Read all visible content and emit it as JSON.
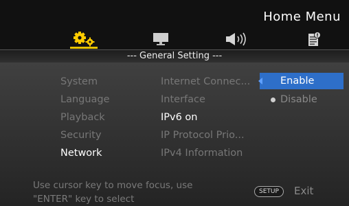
{
  "header": {
    "menu_title": "Home Menu",
    "tabs": [
      {
        "icon": "gear-icon",
        "selected": true
      },
      {
        "icon": "monitor-icon",
        "selected": false
      },
      {
        "icon": "speaker-icon",
        "selected": false
      },
      {
        "icon": "info-document-icon",
        "selected": false
      }
    ]
  },
  "section_title": "--- General Setting ---",
  "categories": [
    "System",
    "Language",
    "Playback",
    "Security",
    "Network"
  ],
  "active_category": "Network",
  "settings": [
    "Internet Connec...",
    "Interface",
    "IPv6 on",
    "IP Protocol Prio...",
    "IPv4 Information"
  ],
  "active_setting": "IPv6 on",
  "options": {
    "enable_label": "Enable",
    "disable_label": "Disable",
    "selected": "Enable"
  },
  "help": {
    "line1": "Use cursor key to move focus, use",
    "line2": "\"ENTER\" key to select",
    "setup_badge": "SETUP",
    "exit_label": "Exit"
  },
  "colors": {
    "accent_highlight": "#2e6fc9",
    "tab_underline": "#e6c200",
    "icon_yellow": "#ffcc00"
  }
}
